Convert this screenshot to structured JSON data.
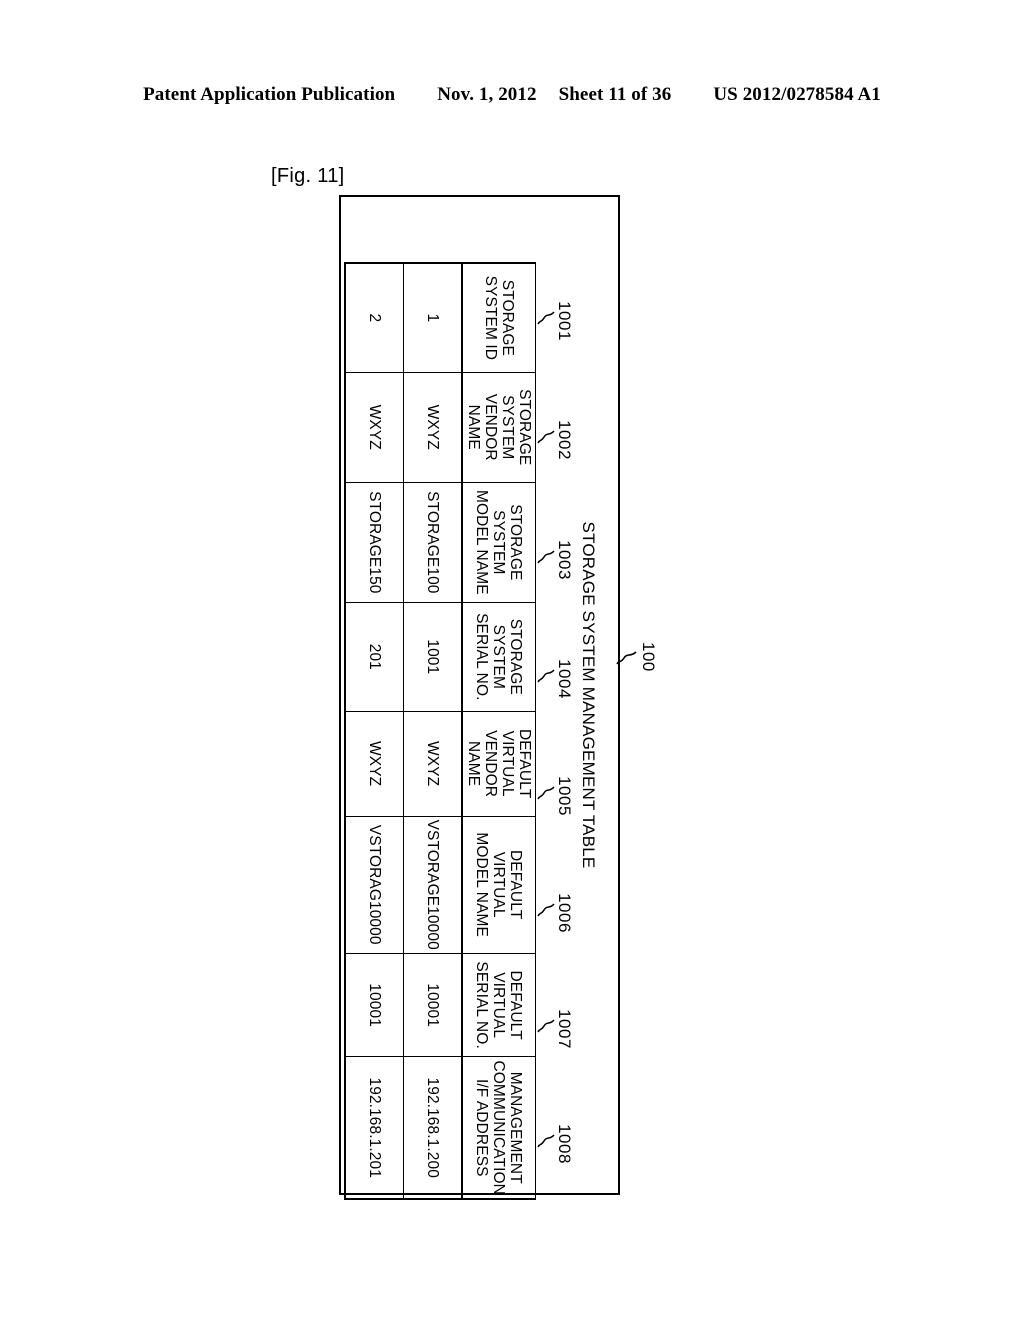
{
  "page_header": {
    "publication": "Patent Application Publication",
    "date": "Nov. 1, 2012",
    "sheet": "Sheet 11 of 36",
    "doc_number": "US 2012/0278584 A1"
  },
  "figure": {
    "label": "[Fig. 11]",
    "table_reference": "100",
    "title": "STORAGE SYSTEM MANAGEMENT TABLE"
  },
  "table": {
    "column_references": [
      "1001",
      "1002",
      "1003",
      "1004",
      "1005",
      "1006",
      "1007",
      "1008"
    ],
    "headers": [
      "STORAGE\nSYSTEM ID",
      "STORAGE\nSYSTEM\nVENDOR NAME",
      "STORAGE\nSYSTEM\nMODEL NAME",
      "STORAGE\nSYSTEM\nSERIAL NO.",
      "DEFAULT\nVIRTUAL\nVENDOR NAME",
      "DEFAULT\nVIRTUAL\nMODEL NAME",
      "DEFAULT\nVIRTUAL\nSERIAL NO.",
      "MANAGEMENT\nCOMMUNICATION\nI/F ADDRESS"
    ],
    "rows": [
      [
        "1",
        "WXYZ",
        "STORAGE100",
        "1001",
        "WXYZ",
        "VSTORAGE10000",
        "10001",
        "192.168.1.200"
      ],
      [
        "2",
        "WXYZ",
        "STORAGE150",
        "201",
        "WXYZ",
        "VSTORAG10000",
        "10001",
        "192.168.1.201"
      ]
    ]
  },
  "colors": {
    "ink": "#000000",
    "paper": "#ffffff"
  }
}
